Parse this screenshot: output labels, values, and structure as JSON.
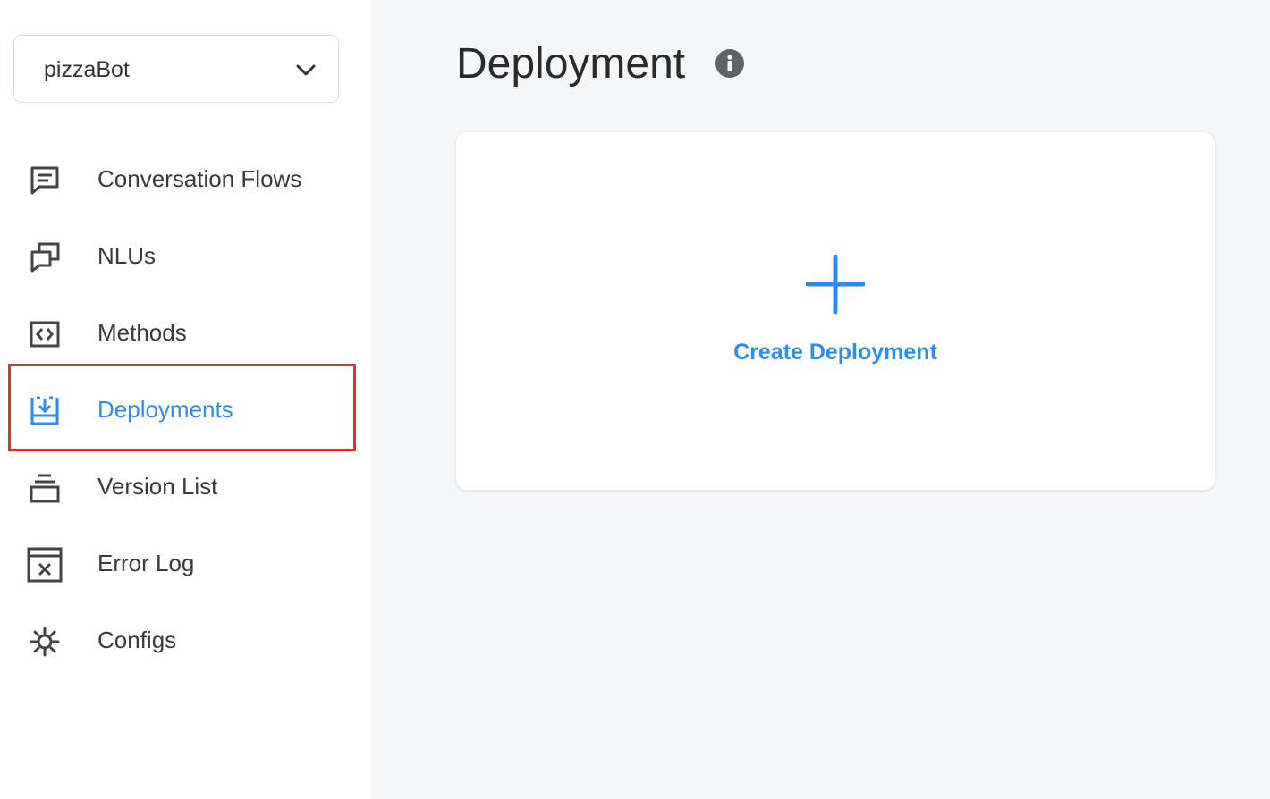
{
  "bot_selector": {
    "value": "pizzaBot"
  },
  "sidebar": {
    "items": [
      {
        "label": "Conversation Flows",
        "icon": "chat-bubble-icon"
      },
      {
        "label": "NLUs",
        "icon": "stacked-windows-icon"
      },
      {
        "label": "Methods",
        "icon": "code-brackets-icon"
      },
      {
        "label": "Deployments",
        "icon": "download-tray-icon",
        "active": true
      },
      {
        "label": "Version List",
        "icon": "stack-layers-icon"
      },
      {
        "label": "Error Log",
        "icon": "error-window-icon"
      },
      {
        "label": "Configs",
        "icon": "gear-icon"
      }
    ]
  },
  "main": {
    "title": "Deployment",
    "create_card": {
      "label": "Create Deployment"
    }
  },
  "colors": {
    "accent": "#2d8cf0",
    "highlight": "#e8302a",
    "background": "#f5f6f8"
  }
}
